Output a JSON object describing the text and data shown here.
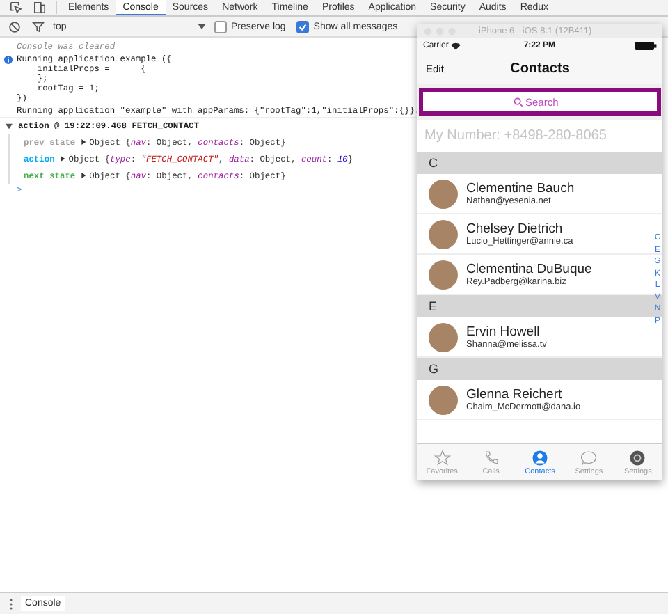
{
  "devtools": {
    "tabs": [
      {
        "label": "Elements",
        "selected": false
      },
      {
        "label": "Console",
        "selected": true
      },
      {
        "label": "Sources",
        "selected": false
      },
      {
        "label": "Network",
        "selected": false
      },
      {
        "label": "Timeline",
        "selected": false
      },
      {
        "label": "Profiles",
        "selected": false
      },
      {
        "label": "Application",
        "selected": false
      },
      {
        "label": "Security",
        "selected": false
      },
      {
        "label": "Audits",
        "selected": false
      },
      {
        "label": "Redux",
        "selected": false
      }
    ],
    "filter": {
      "context": "top",
      "options": [
        {
          "label": "Preserve log",
          "checked": false
        },
        {
          "label": "Show all messages",
          "checked": true
        }
      ]
    },
    "console": [
      {
        "kind": "cleared",
        "text": "Console was cleared"
      },
      {
        "kind": "info",
        "lines": [
          "Running application example ({",
          "    initialProps =      {",
          "    };",
          "    rootTag = 1;",
          "})"
        ]
      },
      {
        "kind": "log",
        "text": "Running application \"example\" with appParams: {\"rootTag\":1,\"initialProps\":{}}."
      },
      {
        "kind": "group",
        "title": "action @ 19:22:09.468 FETCH_CONTACT",
        "expanded": true,
        "entries": [
          {
            "label": "prev state",
            "color": "#9e9e9e",
            "tokens": [
              {
                "kind": "plain",
                "text": "Object {"
              },
              {
                "kind": "key",
                "text": "nav"
              },
              {
                "kind": "plain",
                "text": ": Object, "
              },
              {
                "kind": "key",
                "text": "contacts"
              },
              {
                "kind": "plain",
                "text": ": Object}"
              }
            ]
          },
          {
            "label": "action",
            "color": "#03a9f4",
            "tokens": [
              {
                "kind": "plain",
                "text": "Object {"
              },
              {
                "kind": "key",
                "text": "type"
              },
              {
                "kind": "plain",
                "text": ": "
              },
              {
                "kind": "string",
                "text": "\"FETCH_CONTACT\""
              },
              {
                "kind": "plain",
                "text": ", "
              },
              {
                "kind": "key",
                "text": "data"
              },
              {
                "kind": "plain",
                "text": ": Object, "
              },
              {
                "kind": "key",
                "text": "count"
              },
              {
                "kind": "plain",
                "text": ": "
              },
              {
                "kind": "number",
                "text": "10"
              },
              {
                "kind": "plain",
                "text": "}"
              }
            ]
          },
          {
            "label": "next state",
            "color": "#4caf50",
            "tokens": [
              {
                "kind": "plain",
                "text": "Object {"
              },
              {
                "kind": "key",
                "text": "nav"
              },
              {
                "kind": "plain",
                "text": ": Object, "
              },
              {
                "kind": "key",
                "text": "contacts"
              },
              {
                "kind": "plain",
                "text": ": Object}"
              }
            ]
          }
        ]
      }
    ],
    "prompt": ">",
    "drawer": {
      "tab": "Console"
    }
  },
  "simulator": {
    "window_title": "iPhone 6 - iOS 8.1 (12B411)",
    "status": {
      "carrier": "Carrier",
      "time": "7:22 PM"
    },
    "nav": {
      "left": "Edit",
      "title": "Contacts"
    },
    "search": {
      "placeholder": "Search",
      "focused": true
    },
    "my_number": "My Number: +8498-280-8065",
    "sections": [
      {
        "letter": "C",
        "contacts": [
          {
            "name": "Clementine Bauch",
            "email": "Nathan@yesenia.net"
          },
          {
            "name": "Chelsey Dietrich",
            "email": "Lucio_Hettinger@annie.ca"
          },
          {
            "name": "Clementina DuBuque",
            "email": "Rey.Padberg@karina.biz"
          }
        ]
      },
      {
        "letter": "E",
        "contacts": [
          {
            "name": "Ervin Howell",
            "email": "Shanna@melissa.tv"
          }
        ]
      },
      {
        "letter": "G",
        "contacts": [
          {
            "name": "Glenna Reichert",
            "email": "Chaim_McDermott@dana.io"
          }
        ]
      }
    ],
    "index": [
      "C",
      "E",
      "G",
      "K",
      "L",
      "M",
      "N",
      "P"
    ],
    "tab_bar": [
      {
        "label": "Favorites",
        "selected": false
      },
      {
        "label": "Calls",
        "selected": false
      },
      {
        "label": "Contacts",
        "selected": true
      },
      {
        "label": "Settings",
        "selected": false
      },
      {
        "label": "Settings",
        "selected": false
      }
    ]
  }
}
